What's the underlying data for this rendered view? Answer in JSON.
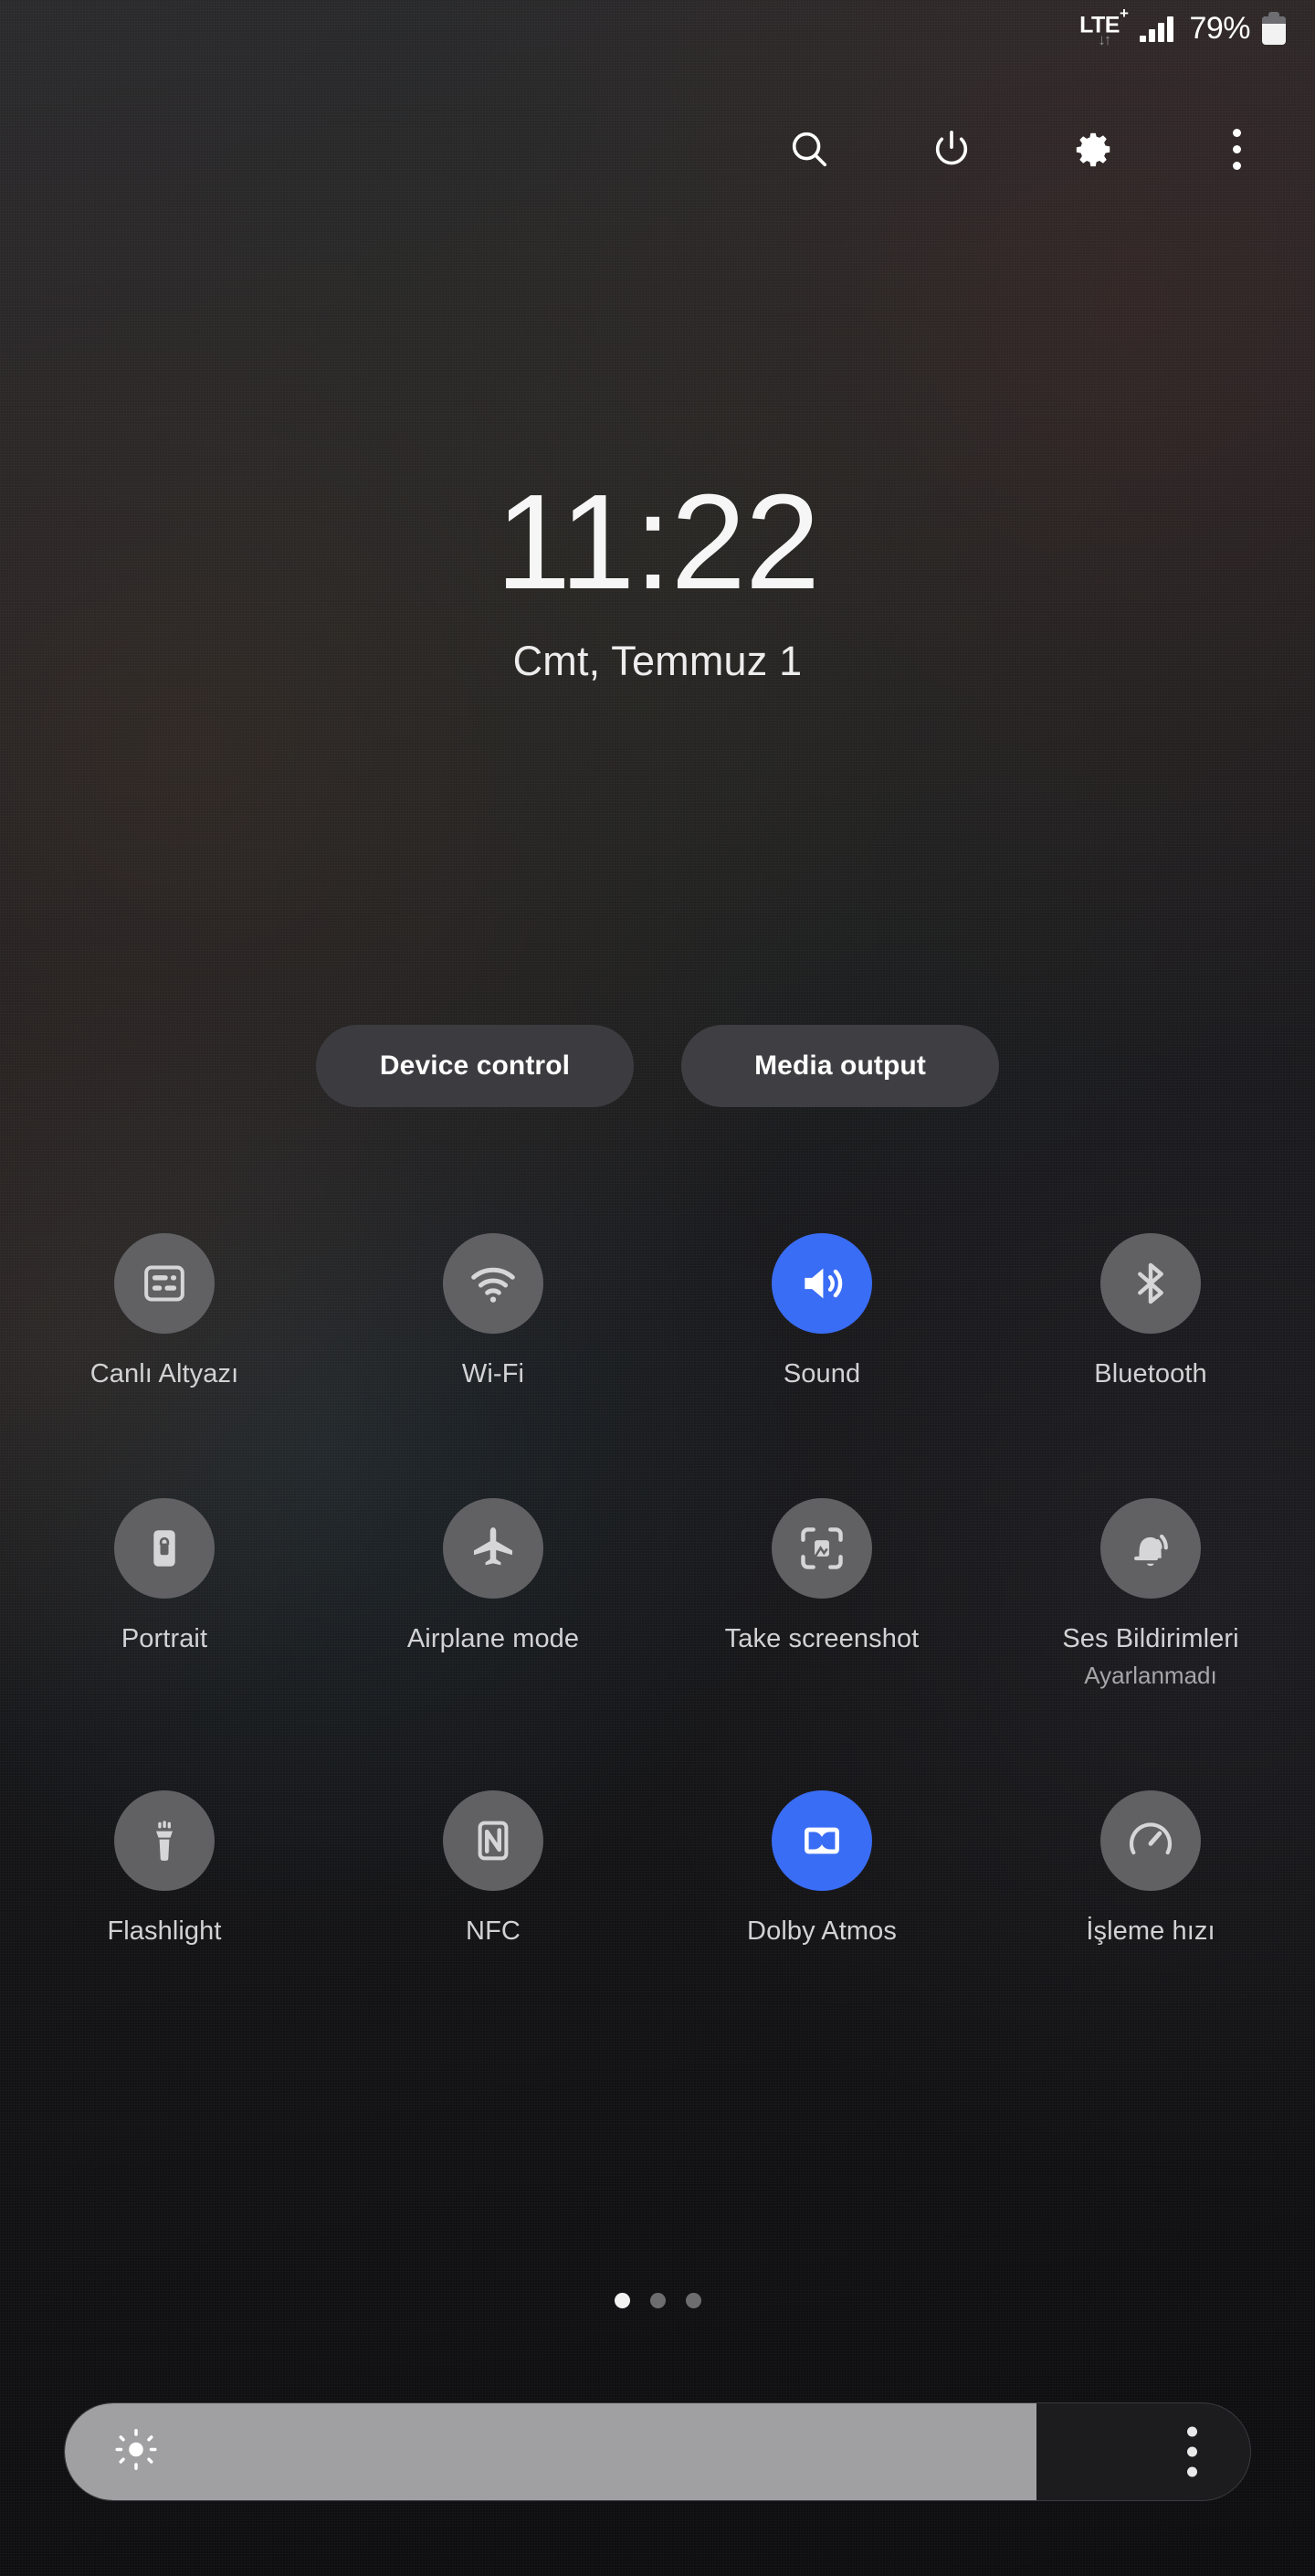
{
  "statusbar": {
    "network_type": "LTE",
    "network_superscript": "+",
    "data_arrows": "↓↑",
    "battery_percent": "79%",
    "signal_bars": 4
  },
  "header": {
    "icons": [
      {
        "name": "search-icon",
        "label": "Search"
      },
      {
        "name": "power-icon",
        "label": "Power off"
      },
      {
        "name": "gear-icon",
        "label": "Settings"
      },
      {
        "name": "overflow-menu-icon",
        "label": "More options"
      }
    ]
  },
  "clock": {
    "time": "11:22",
    "date": "Cmt, Temmuz 1"
  },
  "quick_actions": {
    "device_control": "Device control",
    "media_output": "Media output"
  },
  "colors": {
    "active_toggle": "#3a6df5",
    "inactive_toggle": "#616164",
    "slider_fill": "#a0a0a2",
    "background": "#0d0d0f"
  },
  "toggles": [
    [
      {
        "label": "Canlı Altyazı",
        "sub": "",
        "icon": "live-caption-icon",
        "active": false
      },
      {
        "label": "Wi-Fi",
        "sub": "",
        "icon": "wifi-icon",
        "active": false
      },
      {
        "label": "Sound",
        "sub": "",
        "icon": "sound-icon",
        "active": true
      },
      {
        "label": "Bluetooth",
        "sub": "",
        "icon": "bluetooth-icon",
        "active": false
      }
    ],
    [
      {
        "label": "Portrait",
        "sub": "",
        "icon": "rotation-lock-icon",
        "active": false
      },
      {
        "label": "Airplane mode",
        "sub": "",
        "icon": "airplane-icon",
        "active": false
      },
      {
        "label": "Take screenshot",
        "sub": "",
        "icon": "screenshot-icon",
        "active": false
      },
      {
        "label": "Ses Bildirimleri",
        "sub": "Ayarlanmadı",
        "icon": "sound-notification-icon",
        "active": false
      }
    ],
    [
      {
        "label": "Flashlight",
        "sub": "",
        "icon": "flashlight-icon",
        "active": false
      },
      {
        "label": "NFC",
        "sub": "",
        "icon": "nfc-icon",
        "active": false
      },
      {
        "label": "Dolby Atmos",
        "sub": "",
        "icon": "dolby-atmos-icon",
        "active": true
      },
      {
        "label": "İşleme hızı",
        "sub": "",
        "icon": "processing-speed-icon",
        "active": false
      }
    ]
  ],
  "pagination": {
    "total": 3,
    "active_index": 0
  },
  "brightness": {
    "value_percent": 82,
    "icon": "brightness-sun-icon",
    "menu_icon": "overflow-menu-icon"
  }
}
